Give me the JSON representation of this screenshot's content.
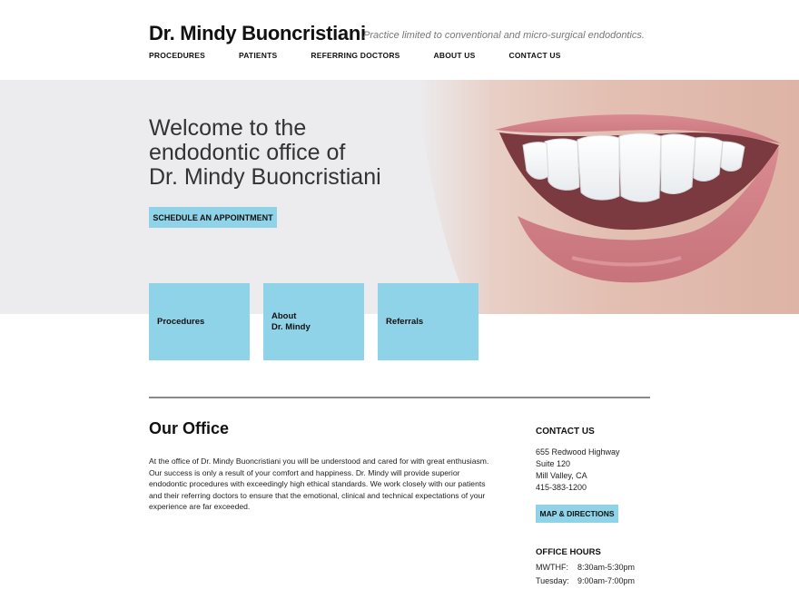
{
  "header": {
    "site_title": "Dr. Mindy Buoncristiani",
    "tagline": "Practice limited to conventional and micro-surgical endodontics."
  },
  "nav": {
    "items": [
      {
        "label": "PROCEDURES"
      },
      {
        "label": "PATIENTS"
      },
      {
        "label": "REFERRING DOCTORS"
      },
      {
        "label": "ABOUT US"
      },
      {
        "label": "CONTACT US"
      }
    ]
  },
  "hero": {
    "heading_lines": [
      "Welcome to the",
      "endodontic office of",
      "Dr. Mindy Buoncristiani"
    ],
    "cta_label": "SCHEDULE AN APPOINTMENT"
  },
  "tiles": [
    {
      "lines": [
        "Procedures"
      ]
    },
    {
      "lines": [
        "About",
        "Dr. Mindy"
      ]
    },
    {
      "lines": [
        "Referrals"
      ]
    }
  ],
  "office": {
    "title": "Our Office",
    "body": "At the office of Dr. Mindy Buoncristiani you will be understood and cared for with great enthusiasm. Our success is only a result of your comfort and happiness. Dr. Mindy will provide superior endodontic procedures with exceedingly high ethical standards. We work closely with our patients and their referring doctors to ensure that the emotional, clinical and technical expectations of your experience are far exceeded."
  },
  "contact": {
    "title": "CONTACT US",
    "address_lines": [
      "655 Redwood Highway",
      "Suite 120",
      "Mill Valley, CA",
      "415-383-1200"
    ],
    "map_label": "MAP & DIRECTIONS"
  },
  "hours": {
    "title": "OFFICE HOURS",
    "rows": [
      {
        "day": "MWTHF:",
        "time": "8:30am-5:30pm"
      },
      {
        "day": "Tuesday:",
        "time": "9:00am-7:00pm"
      }
    ]
  },
  "colors": {
    "accent": "#8fd3e8",
    "hero_bg": "#ececee",
    "divider": "#8a8a8a"
  }
}
